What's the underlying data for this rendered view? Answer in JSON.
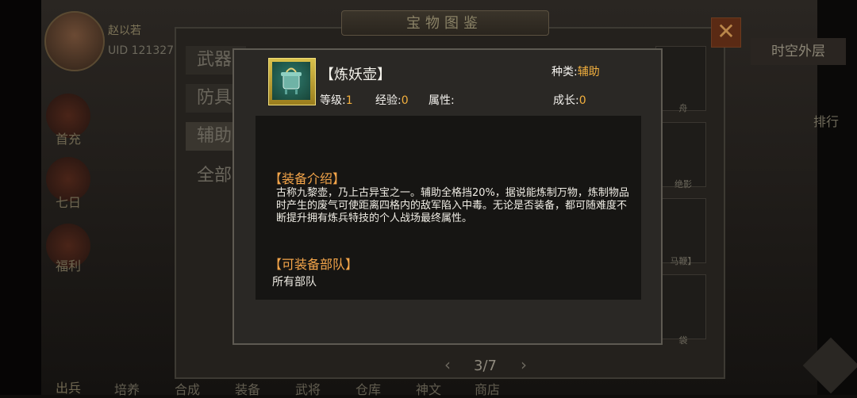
{
  "player": {
    "name": "赵以若",
    "uid": "UID 121327"
  },
  "atlas": {
    "title": "宝物图鉴"
  },
  "side_menu": [
    "首充",
    "七日",
    "福利",
    "出兵"
  ],
  "categories": [
    "武器",
    "防具",
    "辅助",
    "全部"
  ],
  "world_button": "时空外层",
  "rank_button": "排行",
  "slot_labels": [
    "舟",
    "绝影",
    "马鞭】",
    "袋"
  ],
  "pagination": {
    "current": "3/7"
  },
  "bottom_nav": [
    "培养",
    "合成",
    "装备",
    "武将",
    "仓库",
    "神文",
    "商店"
  ],
  "popup": {
    "item_name": "【炼妖壶】",
    "type_label": "种类:",
    "type_value": "辅助",
    "level_label": "等级:",
    "level_value": "1",
    "exp_label": "经验:",
    "exp_value": "0",
    "attr_label": "属性:",
    "growth_label": "成长:",
    "growth_value": "0",
    "intro_heading": "【装备介绍】",
    "intro_text": "古称九黎壶，乃上古异宝之一。辅助全格挡20%，据说能炼制万物，炼制物品时产生的废气可使距离四格内的敌军陷入中毒。无论是否装备，都可随难度不断提升拥有炼兵特技的个人战场最终属性。",
    "units_heading": "【可装备部队】",
    "units_text": "所有部队"
  },
  "colors": {
    "accent_orange": "#f4a54a",
    "value_gold": "#f3b03e",
    "close_red": "#5a2a14"
  }
}
